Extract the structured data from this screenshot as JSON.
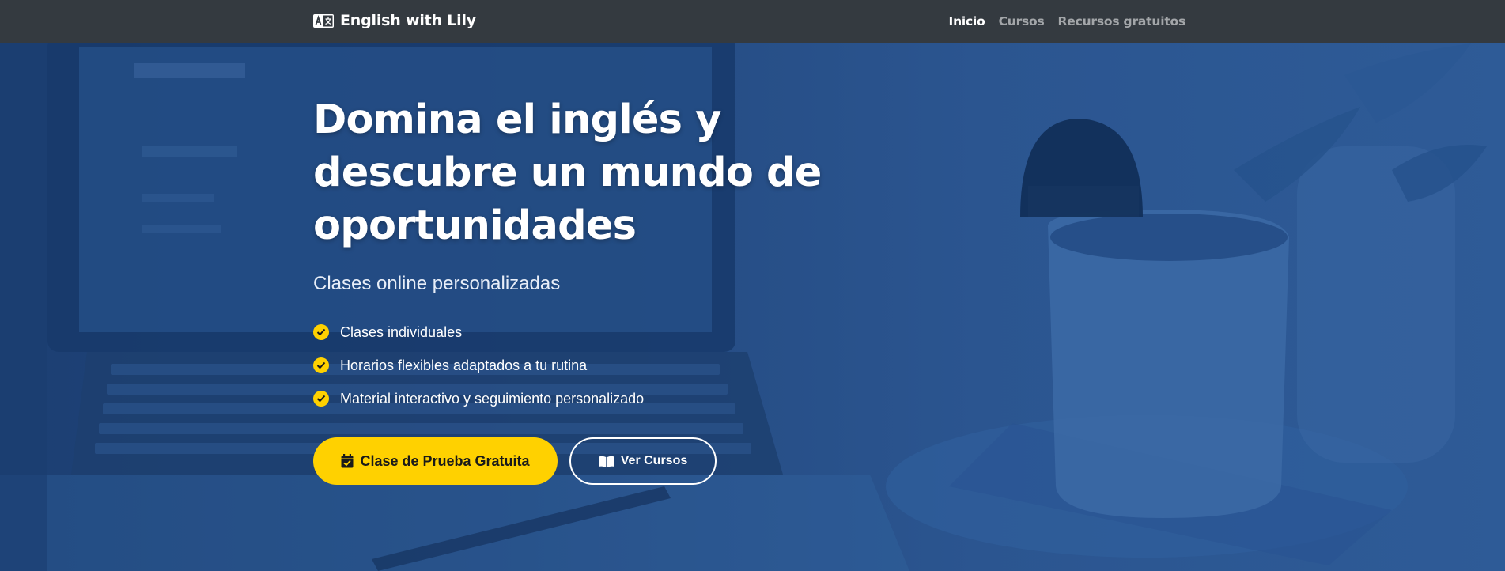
{
  "brand": {
    "name": "English with Lily",
    "icon": "language-icon"
  },
  "nav": {
    "items": [
      {
        "label": "Inicio",
        "active": true
      },
      {
        "label": "Cursos",
        "active": false
      },
      {
        "label": "Recursos gratuitos",
        "active": false
      }
    ]
  },
  "hero": {
    "title": "Domina el inglés y descubre un mundo de oportunidades",
    "subtitle": "Clases online personalizadas",
    "features": [
      {
        "text": "Clases individuales",
        "icon": "check-circle-icon"
      },
      {
        "text": "Horarios flexibles adaptados a tu rutina",
        "icon": "check-circle-icon"
      },
      {
        "text": "Material interactivo y seguimiento personalizado",
        "icon": "check-circle-icon"
      }
    ],
    "cta_primary": {
      "label": "Clase de Prueba Gratuita",
      "icon": "calendar-check-icon"
    },
    "cta_secondary": {
      "label": "Ver Cursos",
      "icon": "book-open-icon"
    }
  },
  "colors": {
    "navbar": "#343a40",
    "hero_overlay": "#2a5590",
    "accent": "#ffd100",
    "text": "#ffffff"
  }
}
